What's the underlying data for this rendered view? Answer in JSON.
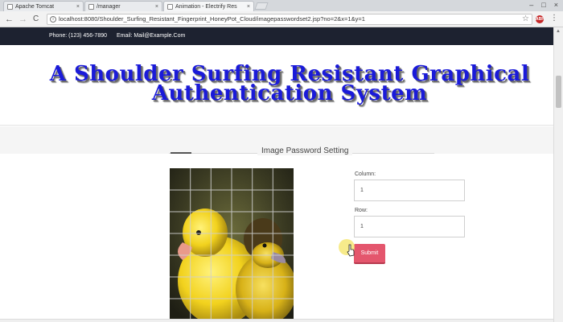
{
  "browser": {
    "tabs": [
      {
        "title": "Apache Tomcat",
        "active": false
      },
      {
        "title": "/manager",
        "active": false
      },
      {
        "title": "Animation - Electrify Res",
        "active": true
      }
    ],
    "close_glyph": "×",
    "url": "localhost:8080/Shoulder_Surfing_Resistant_Fingerprint_HoneyPot_Cloud/imagepasswordset2.jsp?no=2&x=1&y=1",
    "back_glyph": "←",
    "forward_glyph": "→",
    "reload_glyph": "C",
    "star_glyph": "☆",
    "menu_glyph": "⋮",
    "ext_badge": "ABP"
  },
  "topbar": {
    "phone": "Phone: (123) 456-7890",
    "email": "Email: Mail@Example.Com",
    "background": "#1d2230"
  },
  "header": {
    "title_line1": "A Shoulder Surfing Resistant Graphical",
    "title_line2": "Authentication System",
    "title_color": "#1a1ad9"
  },
  "section": {
    "title": "Image Password Setting"
  },
  "grid": {
    "rows": 7,
    "cols": 6,
    "image": "yellow-ducklings"
  },
  "form": {
    "column_label": "Column:",
    "column_value": "1",
    "row_label": "Row:",
    "row_value": "1",
    "submit_label": "Submit",
    "submit_color": "#e4566d"
  }
}
